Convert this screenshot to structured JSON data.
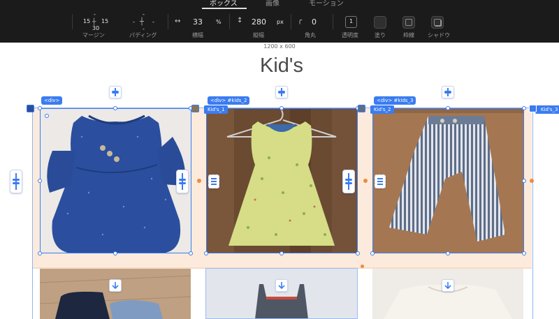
{
  "toolbar": {
    "tabs": [
      {
        "label": "ボックス",
        "active": true
      },
      {
        "label": "画像",
        "active": false
      },
      {
        "label": "モーション",
        "active": false
      }
    ],
    "margin": {
      "top": "-",
      "left": "15",
      "right": "15",
      "bottom": "30",
      "label": "マージン"
    },
    "padding": {
      "top": "-",
      "left": "-",
      "right": "-",
      "bottom": "-",
      "label": "パディング"
    },
    "width": {
      "value": "33",
      "unit": "%",
      "label": "横幅"
    },
    "height": {
      "value": "280",
      "unit": "px",
      "label": "縦幅"
    },
    "radius": {
      "value": "0",
      "label": "角丸"
    },
    "opacity": {
      "value": "1",
      "label": "透明度"
    },
    "fill_label": "塗り",
    "border_label": "枠線",
    "shadow_label": "シャドウ"
  },
  "canvas": {
    "size_label": "1200 x 600",
    "section_title": "Kid's",
    "tags": {
      "div_1": "<div>",
      "div_2": "<div> #kids_2",
      "div_3": "<div> #kids_3",
      "kids_1": "Kid's_1",
      "kids_2": "Kid's_2",
      "kids_3": "Kid's_3"
    }
  },
  "colors": {
    "accent": "#3b7cf0",
    "handle_orange": "#f08a3a",
    "peach_bg": "#fcebdc",
    "toolbar_bg": "#1b1b1b"
  },
  "images": [
    {
      "name": "blue-floral-dress",
      "row": 1
    },
    {
      "name": "yellow-floral-dress",
      "row": 1
    },
    {
      "name": "striped-pants",
      "row": 1
    },
    {
      "name": "navy-shorts",
      "row": 2
    },
    {
      "name": "gray-overall",
      "row": 2
    },
    {
      "name": "cream-knit-top",
      "row": 2
    }
  ]
}
